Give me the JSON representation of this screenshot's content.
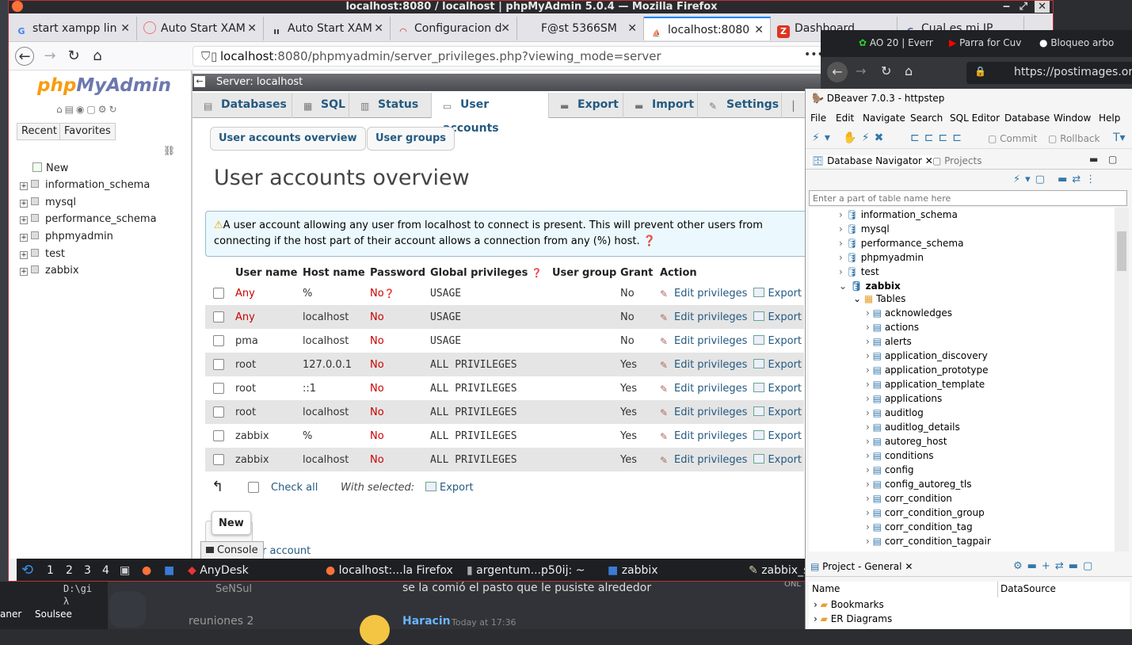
{
  "firefox": {
    "title": "localhost:8080 / localhost | phpMyAdmin 5.0.4 — Mozilla Firefox",
    "tabs": [
      "start xampp lin",
      "Auto Start XAM",
      "Auto Start XAM",
      "Configuracion d",
      "F@st 5366SM",
      "localhost:8080",
      "Dashboard",
      "Cual es mi IP"
    ],
    "url_host": "localhost",
    "url_rest": ":8080/phpmyadmin/server_privileges.php?viewing_mode=server",
    "more": "•••"
  },
  "pma": {
    "logo_php": "php",
    "logo_myadmin": "MyAdmin",
    "recent": "Recent",
    "favorites": "Favorites",
    "databases": [
      "New",
      "information_schema",
      "mysql",
      "performance_schema",
      "phpmyadmin",
      "test",
      "zabbix"
    ],
    "server": "Server: localhost",
    "tabs": [
      "Databases",
      "SQL",
      "Status",
      "User accounts",
      "Export",
      "Import",
      "Settings"
    ],
    "subtabs": [
      "User accounts overview",
      "User groups"
    ],
    "heading": "User accounts overview",
    "notice": "A user account allowing any user from localhost to connect is present. This will prevent other users from connecting if the host part of their account allows a connection from any (%) host.",
    "columns": [
      "User name",
      "Host name",
      "Password",
      "Global privileges",
      "User group",
      "Grant",
      "Action"
    ],
    "rows": [
      {
        "user": "Any",
        "host": "%",
        "password": "No",
        "privs": "USAGE",
        "grant": "No"
      },
      {
        "user": "Any",
        "host": "localhost",
        "password": "No",
        "privs": "USAGE",
        "grant": "No"
      },
      {
        "user": "pma",
        "host": "localhost",
        "password": "No",
        "privs": "USAGE",
        "grant": "No"
      },
      {
        "user": "root",
        "host": "127.0.0.1",
        "password": "No",
        "privs": "ALL PRIVILEGES",
        "grant": "Yes"
      },
      {
        "user": "root",
        "host": "::1",
        "password": "No",
        "privs": "ALL PRIVILEGES",
        "grant": "Yes"
      },
      {
        "user": "root",
        "host": "localhost",
        "password": "No",
        "privs": "ALL PRIVILEGES",
        "grant": "Yes"
      },
      {
        "user": "zabbix",
        "host": "%",
        "password": "No",
        "privs": "ALL PRIVILEGES",
        "grant": "Yes"
      },
      {
        "user": "zabbix",
        "host": "localhost",
        "password": "No",
        "privs": "ALL PRIVILEGES",
        "grant": "Yes"
      }
    ],
    "edit_label": "Edit privileges",
    "export_label": "Export",
    "check_all": "Check all",
    "with_selected": "With selected:",
    "bulk_export": "Export",
    "new_label": "New",
    "console": "Console",
    "add_account": "er account"
  },
  "taskbar": {
    "workspaces": [
      "1",
      "2",
      "3",
      "4"
    ],
    "items": [
      "AnyDesk",
      "localhost:...la Firefox",
      "argentum...p50ij: ~",
      "zabbix",
      "zabbix_s"
    ]
  },
  "chrome": {
    "tabs": [
      "AO 20 | Everr",
      "Parra for Cuv",
      "Bloqueo arbo"
    ],
    "url": "https://postimages.org"
  },
  "dbeaver": {
    "title": "DBeaver 7.0.3 - httpstep",
    "menu": [
      "File",
      "Edit",
      "Navigate",
      "Search",
      "SQL Editor",
      "Database",
      "Window",
      "Help"
    ],
    "commit": "Commit",
    "rollback": "Rollback",
    "nav_tab": "Database Navigator",
    "projects_tab": "Projects",
    "filter_placeholder": "Enter a part of table name here",
    "schemas": [
      "information_schema",
      "mysql",
      "performance_schema",
      "phpmyadmin",
      "test",
      "zabbix"
    ],
    "tables_label": "Tables",
    "tables": [
      "acknowledges",
      "actions",
      "alerts",
      "application_discovery",
      "application_prototype",
      "application_template",
      "applications",
      "auditlog",
      "auditlog_details",
      "autoreg_host",
      "conditions",
      "config",
      "config_autoreg_tls",
      "corr_condition",
      "corr_condition_group",
      "corr_condition_tag",
      "corr_condition_tagpair"
    ],
    "project_panel": "Project - General",
    "col_name": "Name",
    "col_ds": "DataSource",
    "project_items": [
      "Bookmarks",
      "ER Diagrams"
    ]
  },
  "background": {
    "terminal_prompt": "D:\\gi",
    "terminal_lambda": "λ",
    "chat_msg": "se la comió el pasto que le pusiste alrededor",
    "chat_user": "Haracin",
    "chat_time": "Today at 17:36",
    "channel1": "SeNSul",
    "channel2": "reuniones 2",
    "left_app1": "aner",
    "left_app2": "Soulsee",
    "onl": "ONL"
  }
}
